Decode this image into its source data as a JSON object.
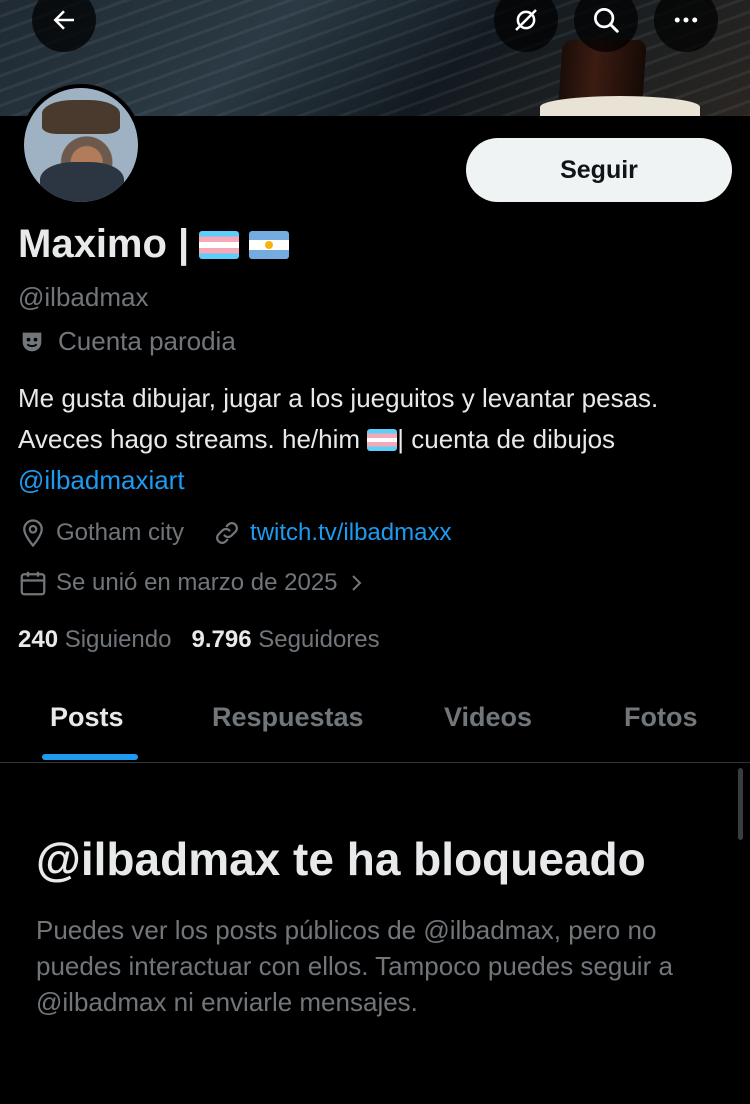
{
  "profile": {
    "name": "Maximo |",
    "handle": "@ilbadmax",
    "parody_label": "Cuenta parodia",
    "bio_part1": "Me gusta dibujar, jugar a los jueguitos y levantar pesas. Aveces hago streams. he/him ",
    "bio_part2": "| cuenta de dibujos ",
    "bio_mention": "@ilbadmaxiart",
    "location": "Gotham city",
    "website": "twitch.tv/ilbadmaxx",
    "joined": "Se unió en marzo de 2025",
    "following_count": "240",
    "following_label": "Siguiendo",
    "followers_count": "9.796",
    "followers_label": "Seguidores"
  },
  "actions": {
    "follow_label": "Seguir"
  },
  "tabs": [
    {
      "label": "Posts",
      "active": true
    },
    {
      "label": "Respuestas",
      "active": false
    },
    {
      "label": "Videos",
      "active": false
    },
    {
      "label": "Fotos",
      "active": false
    }
  ],
  "blocked": {
    "title": "@ilbadmax te ha bloqueado",
    "description": "Puedes ver los posts públicos de @ilbadmax, pero no puedes interactuar con ellos. Tampoco puedes seguir a @ilbadmax ni enviarle mensajes."
  },
  "icons": {
    "back": "back-arrow-icon",
    "grok": "grok-icon",
    "search": "search-icon",
    "more": "more-icon",
    "parody": "parody-mask-icon",
    "location": "location-pin-icon",
    "link": "link-icon",
    "calendar": "calendar-icon",
    "chevron": "chevron-right-icon"
  },
  "colors": {
    "background": "#000000",
    "text": "#e7e9ea",
    "muted": "#71767b",
    "accent": "#1d9bf0",
    "follow_bg": "#eff3f4"
  }
}
